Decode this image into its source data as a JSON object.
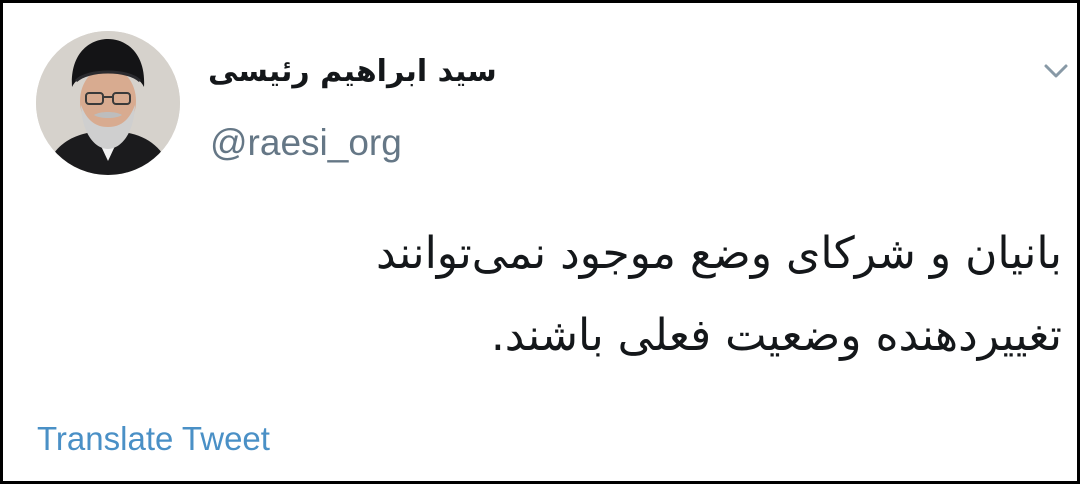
{
  "tweet": {
    "author": {
      "display_name": "سید ابراهیم رئیسی",
      "handle": "@raesi_org",
      "avatar_icon": "profile-photo"
    },
    "menu_icon": "chevron-down-icon",
    "text_lines": [
      "بانیان و شرکای وضع موجود نمی‌توانند",
      "تغییردهنده وضعیت فعلی باشند."
    ],
    "translate_label": "Translate Tweet"
  },
  "colors": {
    "text": "#14171a",
    "secondary": "#657786",
    "link": "#4a90c6",
    "border": "#000000"
  }
}
